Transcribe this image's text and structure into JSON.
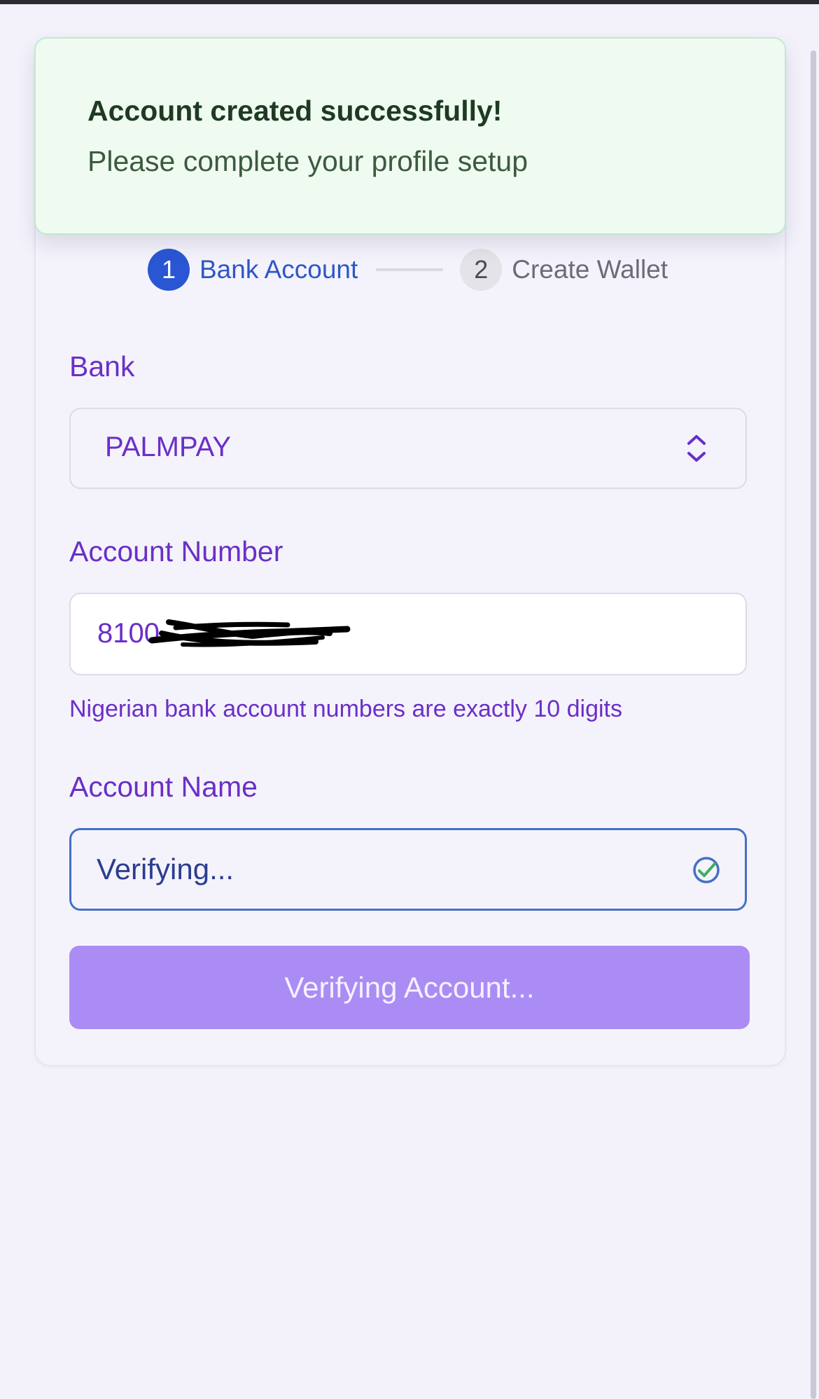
{
  "toast": {
    "title": "Account created successfully!",
    "message": "Please complete your profile setup"
  },
  "stepper": {
    "steps": [
      {
        "number": "1",
        "label": "Bank Account",
        "state": "active"
      },
      {
        "number": "2",
        "label": "Create Wallet",
        "state": "inactive"
      }
    ]
  },
  "form": {
    "bank": {
      "label": "Bank",
      "selected": "PALMPAY",
      "icon": "chevron-up-down-icon"
    },
    "account_number": {
      "label": "Account Number",
      "value": "8100",
      "helper": "Nigerian bank account numbers are exactly 10 digits"
    },
    "account_name": {
      "label": "Account Name",
      "value": "Verifying...",
      "icon": "check-circle-icon"
    },
    "submit_label": "Verifying Account..."
  },
  "colors": {
    "accent_purple": "#6b2fc7",
    "step_active": "#2a56d4",
    "toast_bg": "#effbf1",
    "button_disabled": "#ab8cf4",
    "check_green": "#3fae5b",
    "spinner_blue": "#4570c4"
  }
}
